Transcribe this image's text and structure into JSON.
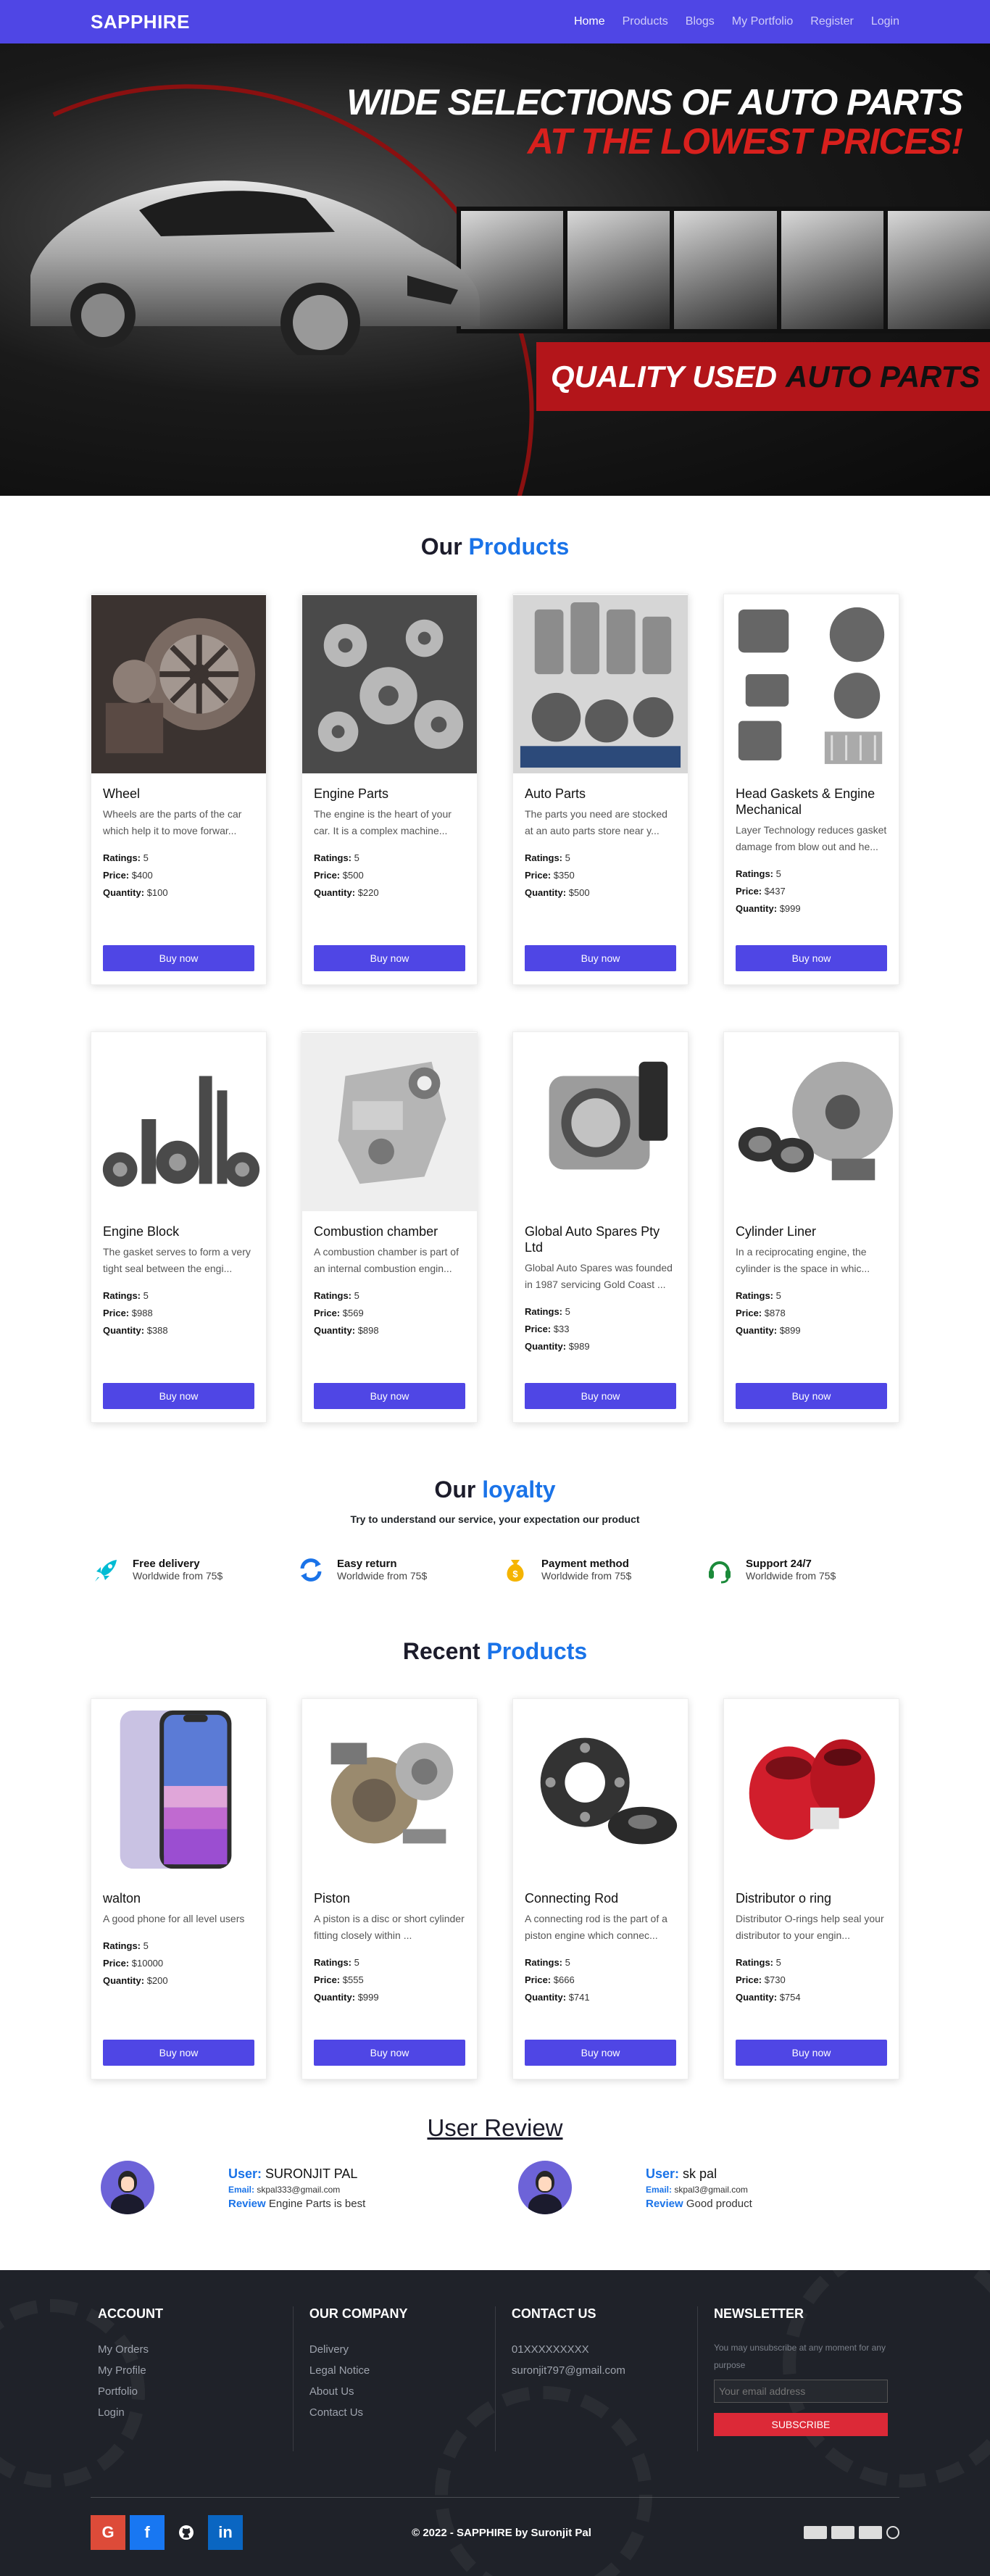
{
  "nav": {
    "brand": "SAPPHIRE",
    "links": [
      "Home",
      "Products",
      "Blogs",
      "My Portfolio",
      "Register",
      "Login"
    ],
    "active": "Home"
  },
  "hero": {
    "line1": "WIDE SELECTIONS OF AUTO PARTS",
    "line2": "AT THE LOWEST PRICES!",
    "banner_white": "QUALITY USED",
    "banner_dark": "AUTO PARTS"
  },
  "products_section": {
    "title": "Our",
    "highlight": "Products"
  },
  "labels": {
    "ratings": "Ratings:",
    "price": "Price:",
    "quantity": "Quantity:",
    "buy": "Buy now"
  },
  "products": [
    {
      "name": "Wheel",
      "desc": "Wheels are the parts of the car which help it to move forwar...",
      "ratings": "5",
      "price": "$400",
      "quantity": "$100",
      "icon": "wheel"
    },
    {
      "name": "Engine Parts",
      "desc": "The engine is the heart of your car. It is a complex machine...",
      "ratings": "5",
      "price": "$500",
      "quantity": "$220",
      "icon": "engine-parts"
    },
    {
      "name": "Auto Parts",
      "desc": "The parts you need are stocked at an auto parts store near y...",
      "ratings": "5",
      "price": "$350",
      "quantity": "$500",
      "icon": "auto-parts"
    },
    {
      "name": "Head Gaskets & Engine Mechanical",
      "desc": "Layer Technology reduces gasket damage from blow out and he...",
      "ratings": "5",
      "price": "$437",
      "quantity": "$999",
      "icon": "gaskets"
    },
    {
      "name": "Engine Block",
      "desc": "The gasket serves to form a very tight seal between the engi...",
      "ratings": "5",
      "price": "$988",
      "quantity": "$388",
      "icon": "engine-block"
    },
    {
      "name": "Combustion chamber",
      "desc": "A combustion chamber is part of an internal combustion engin...",
      "ratings": "5",
      "price": "$569",
      "quantity": "$898",
      "icon": "combustion"
    },
    {
      "name": "Global Auto Spares Pty Ltd",
      "desc": "Global Auto Spares was founded in 1987 servicing Gold Coast ...",
      "ratings": "5",
      "price": "$33",
      "quantity": "$989",
      "icon": "throttle"
    },
    {
      "name": "Cylinder Liner",
      "desc": "In a reciprocating engine, the cylinder is the space in whic...",
      "ratings": "5",
      "price": "$878",
      "quantity": "$899",
      "icon": "brake"
    }
  ],
  "loyalty": {
    "title": "Our",
    "highlight": "loyalty",
    "subtitle": "Try to understand our service, your expectation our product",
    "items": [
      {
        "title": "Free delivery",
        "text": "Worldwide from 75$",
        "icon": "rocket-icon",
        "color": "#00bcd4"
      },
      {
        "title": "Easy return",
        "text": "Worldwide from 75$",
        "icon": "refresh-icon",
        "color": "#1a73e8"
      },
      {
        "title": "Payment method",
        "text": "Worldwide from 75$",
        "icon": "money-bag-icon",
        "color": "#f5b400"
      },
      {
        "title": "Support 24/7",
        "text": "Worldwide from 75$",
        "icon": "headset-icon",
        "color": "#1b8a3a"
      }
    ]
  },
  "recent_section": {
    "title": "Recent",
    "highlight": "Products"
  },
  "recent": [
    {
      "name": "walton",
      "desc": "A good phone for all level users",
      "ratings": "5",
      "price": "$10000",
      "quantity": "$200",
      "icon": "phone"
    },
    {
      "name": "Piston",
      "desc": "A piston is a disc or short cylinder fitting closely within ...",
      "ratings": "5",
      "price": "$555",
      "quantity": "$999",
      "icon": "turbo"
    },
    {
      "name": "Connecting Rod",
      "desc": "A connecting rod is the part of a piston engine which connec...",
      "ratings": "5",
      "price": "$666",
      "quantity": "$741",
      "icon": "spacer"
    },
    {
      "name": "Distributor o ring",
      "desc": "Distributor O-rings help seal your distributor to your engin...",
      "ratings": "5",
      "price": "$730",
      "quantity": "$754",
      "icon": "red-part"
    }
  ],
  "reviews_section": {
    "title": "User Review"
  },
  "review_labels": {
    "user": "User:",
    "email": "Email:",
    "review": "Review"
  },
  "reviews": [
    {
      "user": "SURONJIT PAL",
      "email": "skpal333@gmail.com",
      "review": "Engine Parts is best"
    },
    {
      "user": "sk pal",
      "email": "skpal3@gmail.com",
      "review": "Good product"
    }
  ],
  "footer": {
    "account": {
      "title": "ACCOUNT",
      "links": [
        "My Orders",
        "My Profile",
        "Portfolio",
        "Login"
      ]
    },
    "company": {
      "title": "OUR COMPANY",
      "links": [
        "Delivery",
        "Legal Notice",
        "About Us",
        "Contact Us"
      ]
    },
    "contact": {
      "title": "CONTACT US",
      "lines": [
        "01XXXXXXXXX",
        "suronjit797@gmail.com"
      ]
    },
    "newsletter": {
      "title": "NEWSLETTER",
      "note": "You may unsubscribe at any moment for any purpose",
      "placeholder": "Your email address",
      "button": "SUBSCRIBE"
    },
    "social": [
      {
        "name": "google",
        "glyph": "G",
        "color": "#dd4b39"
      },
      {
        "name": "facebook",
        "glyph": "f",
        "color": "#1877f2"
      },
      {
        "name": "github",
        "glyph": "",
        "color": "#1f2229"
      },
      {
        "name": "linkedin",
        "glyph": "in",
        "color": "#0a66c2"
      }
    ],
    "copyright": "© 2022 - SAPPHIRE by Suronjit Pal",
    "payments": [
      "amex-icon",
      "visa-icon",
      "card-icon",
      "paypal-icon"
    ]
  }
}
